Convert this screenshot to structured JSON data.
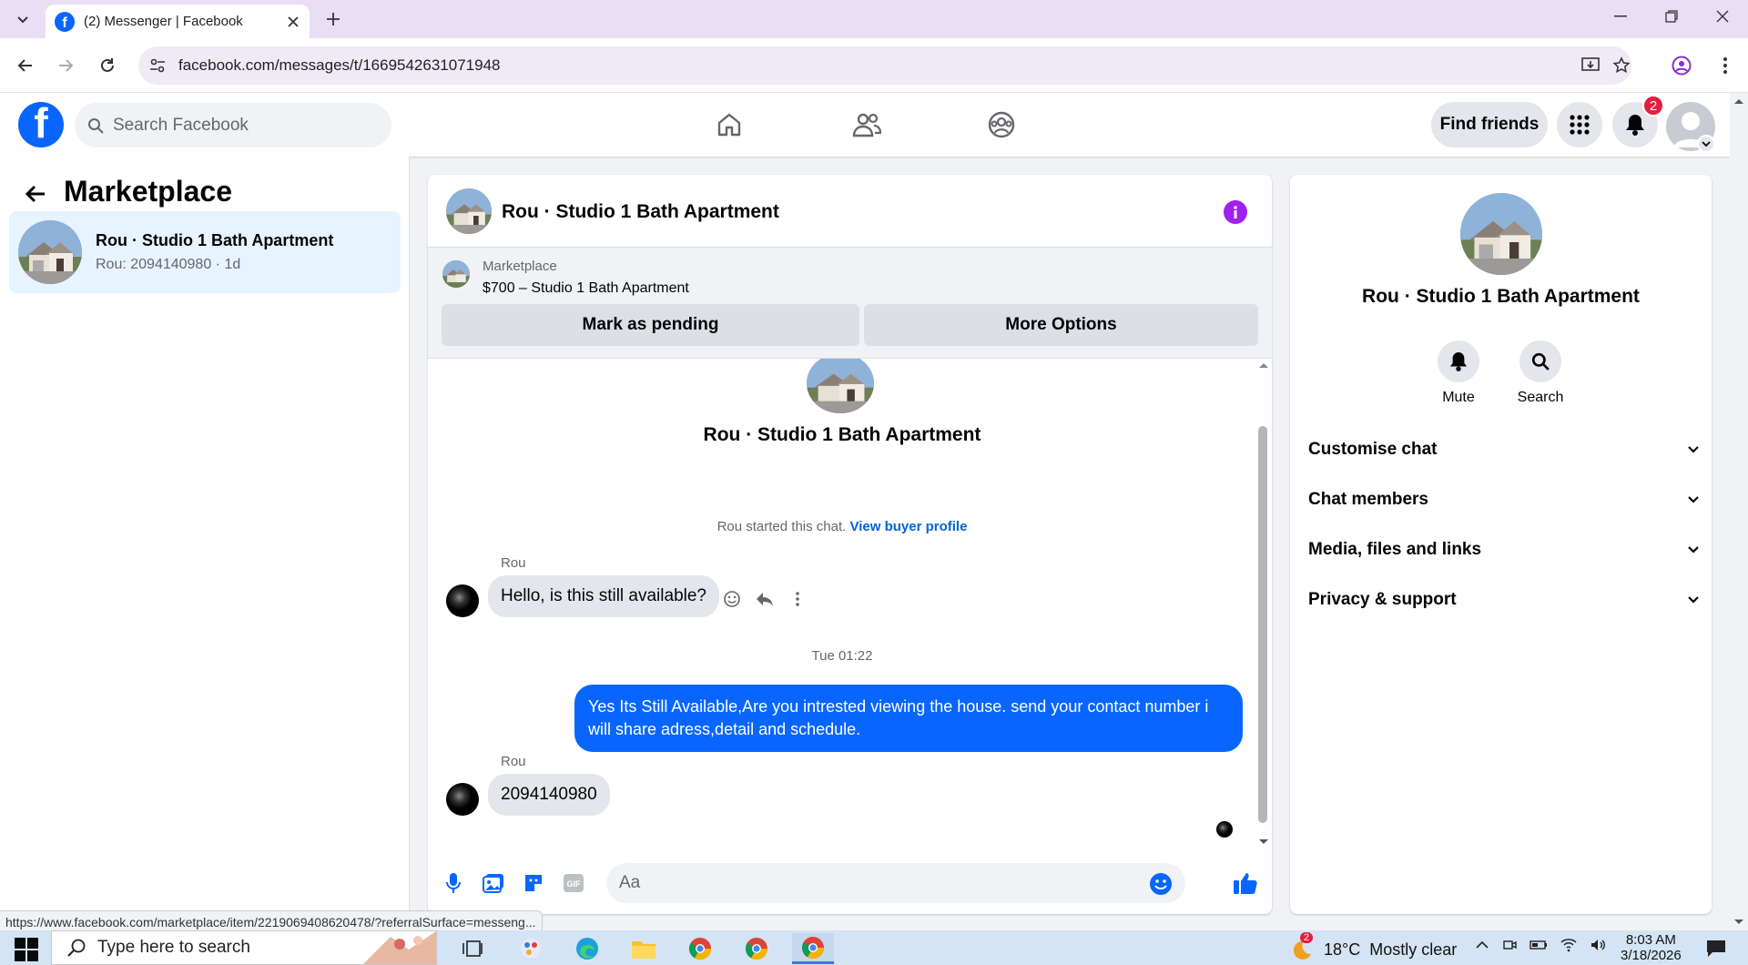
{
  "browser": {
    "tab_title": "(2) Messenger | Facebook",
    "url": "facebook.com/messages/t/1669542631071948",
    "status_url": "https://www.facebook.com/marketplace/item/2219069408620478/?referralSurface=messeng..."
  },
  "header": {
    "search_placeholder": "Search Facebook",
    "find_friends_label": "Find friends",
    "notification_count": "2",
    "nav_icons": [
      "home-icon",
      "friends-icon",
      "groups-icon"
    ]
  },
  "sidebar": {
    "title": "Marketplace",
    "conversations": [
      {
        "name": "Rou · Studio 1 Bath Apartment",
        "subtitle": "Rou: 2094140980 · 1d"
      }
    ]
  },
  "chat": {
    "title": "Rou · Studio 1 Bath Apartment",
    "listing": {
      "label": "Marketplace",
      "price_title": "$700 – Studio 1 Bath Apartment",
      "mark_pending_label": "Mark as pending",
      "more_options_label": "More Options"
    },
    "intro_name": "Rou · Studio 1 Bath Apartment",
    "started_text": "Rou started this chat.",
    "view_profile_link": "View buyer profile",
    "messages": [
      {
        "sender": "Rou",
        "text": "Hello, is this still available?",
        "direction": "in"
      },
      {
        "separator": "Tue 01:22"
      },
      {
        "text": "Yes Its Still Available,Are you intrested viewing the house. send your contact number i will share adress,detail and schedule.",
        "direction": "out"
      },
      {
        "sender": "Rou",
        "text": "2094140980",
        "direction": "in"
      }
    ],
    "input_placeholder": "Aa"
  },
  "details": {
    "name": "Rou · Studio 1 Bath Apartment",
    "actions": [
      {
        "label": "Mute",
        "icon": "bell-icon"
      },
      {
        "label": "Search",
        "icon": "search-icon"
      }
    ],
    "sections": [
      "Customise chat",
      "Chat members",
      "Media, files and links",
      "Privacy & support"
    ]
  },
  "taskbar": {
    "search_placeholder": "Type here to search",
    "weather": "18°C  Mostly clear",
    "weather_badge": "2",
    "time": "8:03 AM",
    "date": "3/18/2026"
  },
  "colors": {
    "brand": "#0866ff",
    "outgoing_bubble": "#0866ff",
    "info_icon": "#a020f0",
    "badge": "#e41e3f"
  }
}
